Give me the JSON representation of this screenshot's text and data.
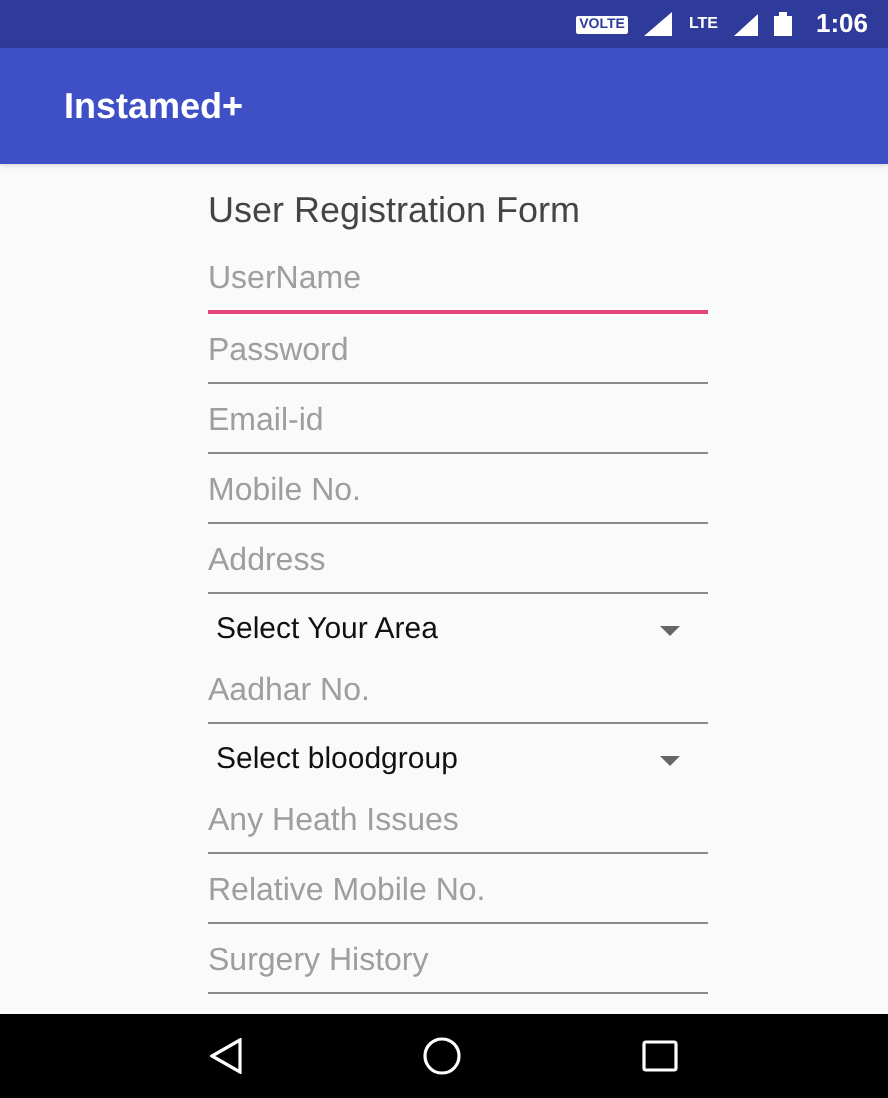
{
  "status_bar": {
    "volte": "VOLTE",
    "network": "LTE",
    "time": "1:06"
  },
  "app_bar": {
    "title": "Instamed+"
  },
  "form": {
    "title": "User Registration Form",
    "fields": [
      {
        "kind": "text",
        "placeholder": "UserName",
        "focused": true
      },
      {
        "kind": "text",
        "placeholder": "Password",
        "focused": false
      },
      {
        "kind": "text",
        "placeholder": "Email-id",
        "focused": false
      },
      {
        "kind": "text",
        "placeholder": "Mobile No.",
        "focused": false
      },
      {
        "kind": "text",
        "placeholder": "Address",
        "focused": false
      },
      {
        "kind": "select",
        "value": "Select Your Area"
      },
      {
        "kind": "text",
        "placeholder": "Aadhar No.",
        "focused": false
      },
      {
        "kind": "select",
        "value": "Select bloodgroup"
      },
      {
        "kind": "text",
        "placeholder": "Any Heath Issues",
        "focused": false
      },
      {
        "kind": "text",
        "placeholder": "Relative Mobile No.",
        "focused": false
      },
      {
        "kind": "text",
        "placeholder": "Surgery History",
        "focused": false
      }
    ]
  }
}
